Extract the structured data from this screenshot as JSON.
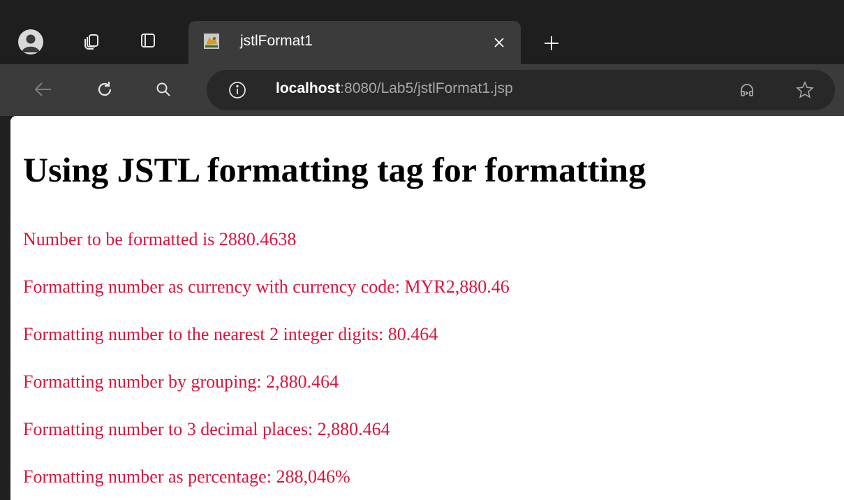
{
  "browser": {
    "tab": {
      "title": "jstlFormat1",
      "favicon": "tomcat-icon"
    },
    "address_bar": {
      "host": "localhost",
      "rest": ":8080/Lab5/jstlFormat1.jsp"
    },
    "icons": [
      "profile-icon",
      "collections-icon",
      "tab-actions-icon",
      "close-icon",
      "plus-icon",
      "back-arrow-icon",
      "refresh-icon",
      "search-icon",
      "info-icon",
      "read-aloud-icon",
      "star-icon"
    ]
  },
  "page": {
    "heading": "Using JSTL formatting tag for formatting",
    "lines": [
      "Number to be formatted is 2880.4638",
      "Formatting number as currency with currency code: MYR2,880.46",
      "Formatting number to the nearest 2 integer digits: 80.464",
      "Formatting number by grouping: 2,880.464",
      "Formatting number to 3 decimal places: 2,880.464",
      "Formatting number as percentage: 288,046%"
    ],
    "text_color": "#dc143c"
  }
}
